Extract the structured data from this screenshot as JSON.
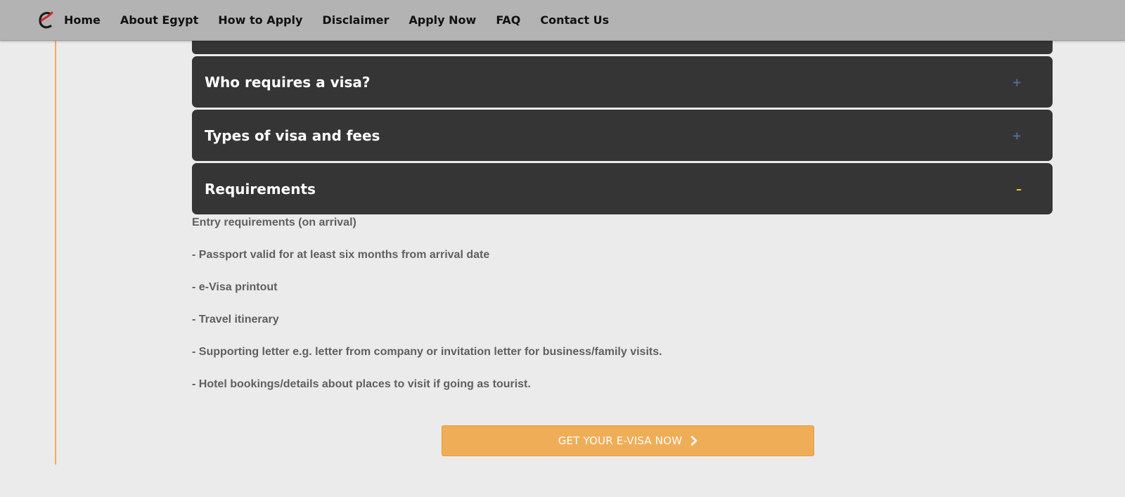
{
  "nav": {
    "items": [
      {
        "label": "Home"
      },
      {
        "label": "About Egypt"
      },
      {
        "label": "How to Apply"
      },
      {
        "label": "Disclaimer"
      },
      {
        "label": "Apply Now"
      },
      {
        "label": "FAQ"
      },
      {
        "label": "Contact Us"
      }
    ]
  },
  "accordion": {
    "items": [
      {
        "title": "Who requires a visa?",
        "sign": "+",
        "expanded": false
      },
      {
        "title": "Types of visa and fees",
        "sign": "+",
        "expanded": false
      },
      {
        "title": "Requirements",
        "sign": "–",
        "expanded": true
      }
    ]
  },
  "requirements": {
    "lines": [
      "Entry requirements (on arrival)",
      "- Passport valid for at least six months from arrival date",
      "- e-Visa printout",
      "- Travel itinerary",
      "- Supporting letter e.g. letter from company or invitation letter for business/family visits.",
      "- Hotel bookings/details about places to visit if going as tourist."
    ]
  },
  "cta": {
    "label": "GET YOUR E-VISA NOW"
  },
  "colors": {
    "accent": "#f0ad57",
    "accordion_bg": "#353535",
    "plus_sign": "#4f7196",
    "minus_sign": "#f5c32c"
  },
  "icons": {
    "logo": "e-logo-icon",
    "cta": "chevron-right-icon"
  }
}
